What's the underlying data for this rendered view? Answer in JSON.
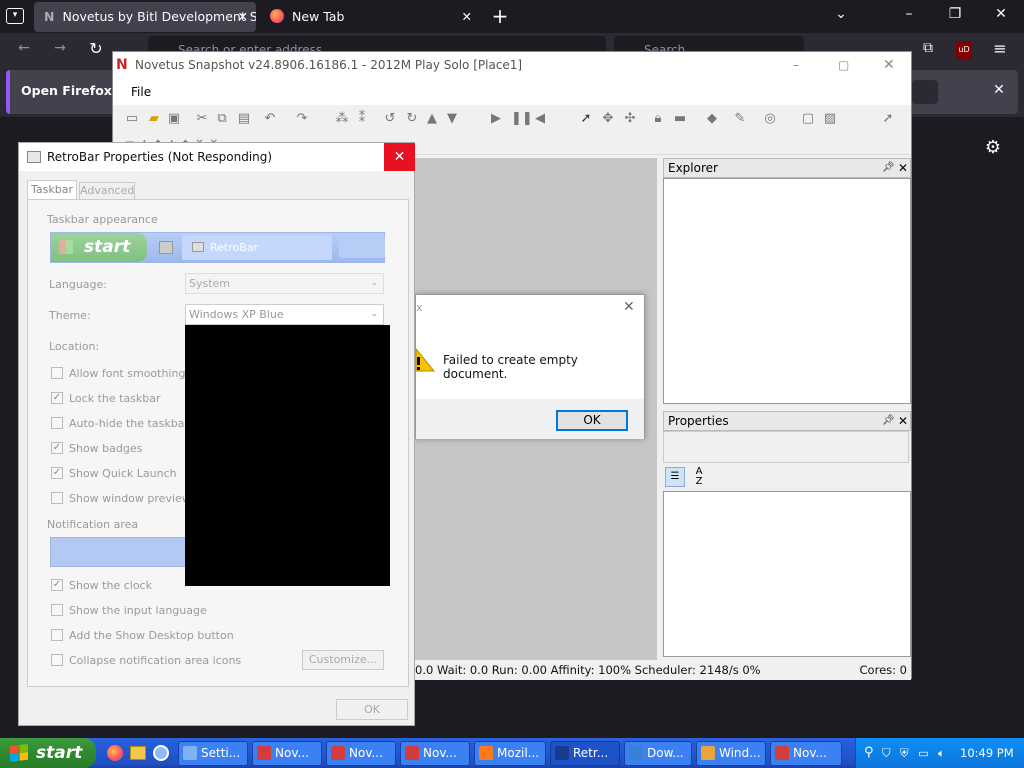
{
  "firefox": {
    "tabs": [
      {
        "title": "Novetus by Bitl Development St",
        "active": true
      },
      {
        "title": "New Tab",
        "active": false
      }
    ],
    "notification": "Open Firefox ev",
    "address_placeholder": "Search or enter address",
    "search_placeholder": "Search"
  },
  "novetus": {
    "title": "Novetus Snapshot v24.8906.16186.1 - 2012M Play Solo [Place1]",
    "menu": [
      "File"
    ],
    "explorer_title": "Explorer",
    "properties_title": "Properties",
    "status_left": "0.0 Wait: 0.0 Run: 0.00 Affinity: 100% Scheduler: 2148/s 0%",
    "status_right": "Cores: 0"
  },
  "error_dialog": {
    "message": "Failed to create empty document.",
    "ok_label": "OK"
  },
  "retrobar": {
    "title": "RetroBar Properties (Not Responding)",
    "tabs": [
      "Taskbar",
      "Advanced"
    ],
    "section_appearance": "Taskbar appearance",
    "preview_start": "start",
    "preview_app": "RetroBar",
    "language_label": "Language:",
    "language_value": "System",
    "theme_label": "Theme:",
    "theme_value": "Windows XP Blue",
    "location_label": "Location:",
    "checkboxes": [
      {
        "label": "Allow font smoothing",
        "checked": false
      },
      {
        "label": "Lock the taskbar",
        "checked": true
      },
      {
        "label": "Auto-hide the taskbar",
        "checked": false
      },
      {
        "label": "Show badges",
        "checked": true
      },
      {
        "label": "Show Quick Launch",
        "checked": true
      },
      {
        "label": "Show window previews",
        "checked": false
      }
    ],
    "section_notification": "Notification area",
    "notif_checkboxes": [
      {
        "label": "Show the clock",
        "checked": true
      },
      {
        "label": "Show the input language",
        "checked": false
      },
      {
        "label": "Add the Show Desktop button",
        "checked": false
      },
      {
        "label": "Collapse notification area icons",
        "checked": false
      }
    ],
    "customize_label": "Customize...",
    "ok_label": "OK"
  },
  "taskbar": {
    "start_label": "start",
    "tasks": [
      {
        "label": "Setti...",
        "icon": "gear-icon",
        "color": "#7fb2f0"
      },
      {
        "label": "Nov...",
        "icon": "novetus-icon",
        "color": "#d23c3c"
      },
      {
        "label": "Nov...",
        "icon": "novetus-icon",
        "color": "#d23c3c"
      },
      {
        "label": "Nov...",
        "icon": "novetus-icon",
        "color": "#d23c3c"
      },
      {
        "label": "Mozil...",
        "icon": "firefox-icon",
        "color": "#ff7a1a"
      },
      {
        "label": "Retr...",
        "icon": "retrobar-icon",
        "color": "#173c8c"
      },
      {
        "label": "Dow...",
        "icon": "download-icon",
        "color": "#3a7fd6"
      },
      {
        "label": "Wind...",
        "icon": "folder-icon",
        "color": "#e8a53c"
      },
      {
        "label": "Nov...",
        "icon": "novetus-icon",
        "color": "#d23c3c"
      }
    ],
    "clock": "10:49 PM"
  }
}
